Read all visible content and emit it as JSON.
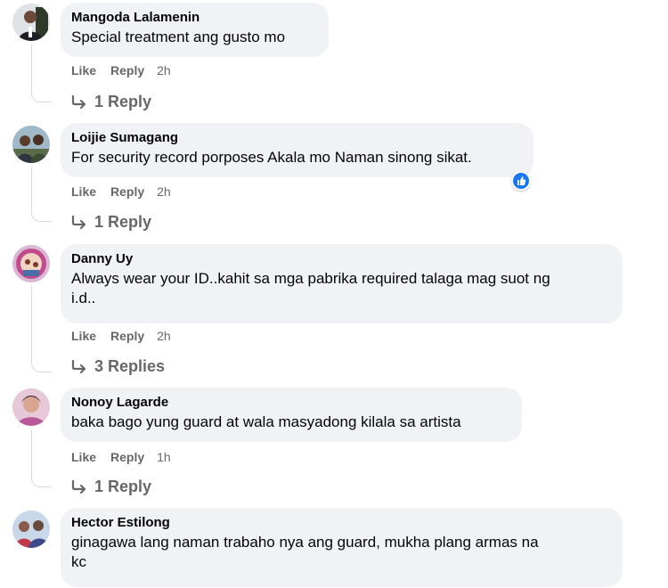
{
  "comments": [
    {
      "author": "Mangoda Lalamenin",
      "text": "Special treatment ang gusto mo",
      "like_label": "Like",
      "reply_label": "Reply",
      "time": "2h",
      "replies_label": "1 Reply"
    },
    {
      "author": "Loijie Sumagang",
      "text": "For security record porposes Akala mo Naman sinong sikat.",
      "like_label": "Like",
      "reply_label": "Reply",
      "time": "2h",
      "replies_label": "1 Reply",
      "reaction_icon": "like-reaction-icon"
    },
    {
      "author": "Danny Uy",
      "text": "Always wear your ID..kahit sa mga pabrika required talaga mag suot ng",
      "text_line2": "i.d..",
      "like_label": "Like",
      "reply_label": "Reply",
      "time": "2h",
      "replies_label": "3 Replies"
    },
    {
      "author": "Nonoy Lagarde",
      "text": "baka bago yung guard at wala masyadong kilala sa artista",
      "like_label": "Like",
      "reply_label": "Reply",
      "time": "1h",
      "replies_label": "1 Reply"
    },
    {
      "author": "Hector Estilong",
      "text": "ginagawa lang naman trabaho nya ang guard, mukha plang armas na",
      "text_line2": "kc"
    }
  ],
  "colors": {
    "bubble": "#f0f2f5",
    "meta_text": "#65676b",
    "like_blue": "#1877f2"
  }
}
